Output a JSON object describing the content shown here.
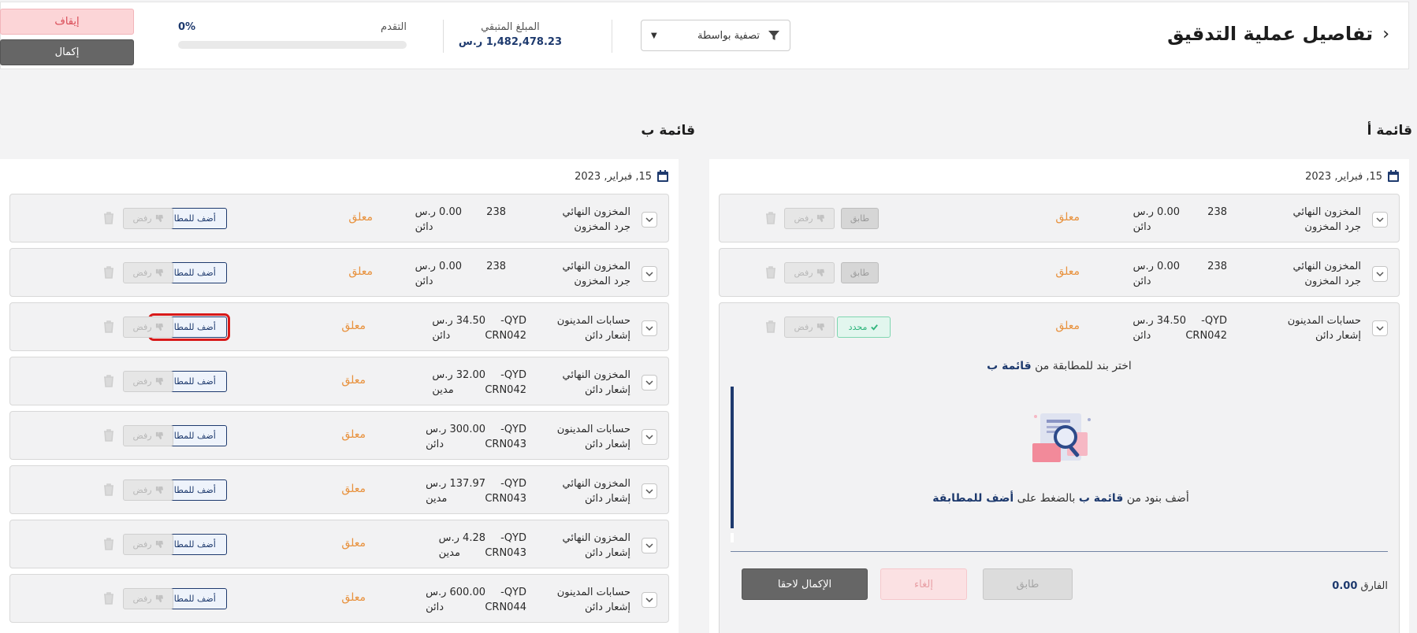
{
  "header": {
    "title": "تفاصيل عملية التدقيق",
    "filter_label": "تصفية بواسطة",
    "remaining_label": "المبلغ المتبقي",
    "remaining_value": "1,482,478.23 ر.س",
    "progress_label": "التقدم",
    "progress_value": "0%",
    "progress_fraction": 0,
    "stop_label": "إيقاف",
    "complete_label": "إكمال"
  },
  "list_a": {
    "title": "قائمة أ",
    "date": "15, فبراير, 2023",
    "items": [
      {
        "account": "المخزون النهائي",
        "account_sub": "جرد المخزون",
        "ref": "238",
        "amount": "0.00 ر.س",
        "side": "دائن",
        "status": "معلق",
        "match_label": "طابق",
        "reject_label": "رفض"
      },
      {
        "account": "المخزون النهائي",
        "account_sub": "جرد المخزون",
        "ref": "238",
        "amount": "0.00 ر.س",
        "side": "دائن",
        "status": "معلق",
        "match_label": "طابق",
        "reject_label": "رفض"
      },
      {
        "account": "حسابات المدينون",
        "account_sub": "إشعار دائن",
        "ref": "QYD-",
        "ref_sub": "CRN042",
        "amount": "34.50 ر.س",
        "side": "دائن",
        "status": "معلق",
        "selected_label": "محدد",
        "reject_label": "رفض"
      }
    ],
    "expanded": {
      "prompt_pre": "اختر بند للمطابقة من",
      "prompt_list": "قائمة ب",
      "hint_pre": "أضف بنود من",
      "hint_list": "قائمة ب",
      "hint_mid": "بالضغط على",
      "hint_action": "أضف للمطابقة",
      "diff_label": "الفارق",
      "diff_value": "0.00",
      "match_label": "طابق",
      "cancel_label": "إلغاء",
      "later_label": "الإكمال لاحقا"
    }
  },
  "list_b": {
    "title": "قائمة ب",
    "date": "15, فبراير, 2023",
    "add_label": "أضف للمطابقة",
    "reject_label": "رفض",
    "items": [
      {
        "account": "المخزون النهائي",
        "account_sub": "جرد المخزون",
        "ref": "238",
        "ref_sub": "",
        "amount": "0.00 ر.س",
        "side": "دائن",
        "status": "معلق"
      },
      {
        "account": "المخزون النهائي",
        "account_sub": "جرد المخزون",
        "ref": "238",
        "ref_sub": "",
        "amount": "0.00 ر.س",
        "side": "دائن",
        "status": "معلق"
      },
      {
        "account": "حسابات المدينون",
        "account_sub": "إشعار دائن",
        "ref": "QYD-",
        "ref_sub": "CRN042",
        "amount": "34.50 ر.س",
        "side": "دائن",
        "status": "معلق"
      },
      {
        "account": "المخزون النهائي",
        "account_sub": "إشعار دائن",
        "ref": "QYD-",
        "ref_sub": "CRN042",
        "amount": "32.00 ر.س",
        "side": "مدين",
        "status": "معلق"
      },
      {
        "account": "حسابات المدينون",
        "account_sub": "إشعار دائن",
        "ref": "QYD-",
        "ref_sub": "CRN043",
        "amount": "300.00 ر.س",
        "side": "دائن",
        "status": "معلق"
      },
      {
        "account": "المخزون النهائي",
        "account_sub": "إشعار دائن",
        "ref": "QYD-",
        "ref_sub": "CRN043",
        "amount": "137.97 ر.س",
        "side": "مدين",
        "status": "معلق"
      },
      {
        "account": "المخزون النهائي",
        "account_sub": "إشعار دائن",
        "ref": "QYD-",
        "ref_sub": "CRN043",
        "amount": "4.28 ر.س",
        "side": "مدين",
        "status": "معلق"
      },
      {
        "account": "حسابات المدينون",
        "account_sub": "إشعار دائن",
        "ref": "QYD-",
        "ref_sub": "CRN044",
        "amount": "600.00 ر.س",
        "side": "دائن",
        "status": "معلق"
      }
    ]
  },
  "colors": {
    "brand": "#1e3a6e",
    "pending": "#e8913c",
    "selected": "#2eb57c",
    "stop": "#d94a55"
  }
}
